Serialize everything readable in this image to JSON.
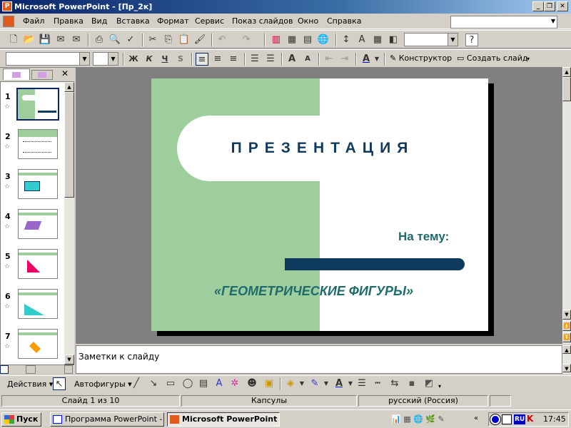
{
  "window": {
    "title": "Microsoft PowerPoint - [Пр_2к]"
  },
  "menu": {
    "items": [
      "Файл",
      "Правка",
      "Вид",
      "Вставка",
      "Формат",
      "Сервис",
      "Показ слайдов",
      "Окно",
      "Справка"
    ]
  },
  "toolbar": {
    "constructor": "Конструктор",
    "new_slide": "Создать слайд",
    "bold": "Ж",
    "italic": "К",
    "underline": "Ч",
    "shadow": "S"
  },
  "slides": {
    "numbers": [
      "1",
      "2",
      "3",
      "4",
      "5",
      "6",
      "7"
    ]
  },
  "slide": {
    "title": "ПРЕЗЕНТАЦИЯ",
    "subtitle": "На тему:",
    "topic": "«ГЕОМЕТРИЧЕСКИЕ ФИГУРЫ»",
    "colors": {
      "green": "#9ecd9e",
      "navy": "#103a5c",
      "teal": "#1f6b6b"
    }
  },
  "notes": {
    "placeholder": "Заметки к слайду"
  },
  "drawing": {
    "actions": "Действия",
    "autoshapes": "Автофигуры"
  },
  "status": {
    "slide": "Слайд 1 из 10",
    "design": "Капсулы",
    "language": "русский (Россия)"
  },
  "taskbar": {
    "start": "Пуск",
    "items": [
      "Программа PowerPoint - ...",
      "Microsoft PowerPoint -..."
    ],
    "clock": "17:45",
    "lang": "RU"
  }
}
